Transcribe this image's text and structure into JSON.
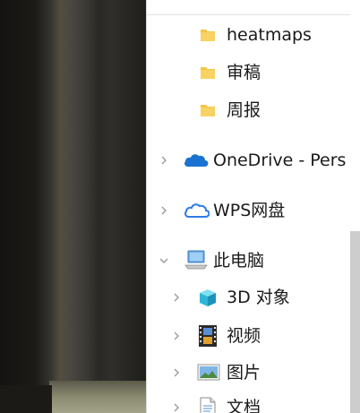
{
  "nav_tree": {
    "folders": [
      {
        "label": "heatmaps",
        "icon": "folder-icon"
      },
      {
        "label": "审稿",
        "icon": "folder-icon"
      },
      {
        "label": "周报",
        "icon": "folder-icon"
      }
    ],
    "onedrive": {
      "label": "OneDrive - Pers",
      "icon": "onedrive-cloud-icon"
    },
    "wps": {
      "label": "WPS网盘",
      "icon": "wps-cloud-icon"
    },
    "this_pc": {
      "label": "此电脑",
      "icon": "computer-icon",
      "expanded": true
    },
    "pc_items": [
      {
        "label": "3D 对象",
        "icon": "3d-objects-icon"
      },
      {
        "label": "视频",
        "icon": "video-icon"
      },
      {
        "label": "图片",
        "icon": "pictures-icon"
      },
      {
        "label": "文档",
        "icon": "documents-icon"
      }
    ]
  },
  "colors": {
    "folder": "#f4c542",
    "onedrive": "#1a73d0",
    "wps": "#2e7ce8",
    "scroll_thumb": "#cdcdcd",
    "chevron": "#9a9a9a"
  }
}
